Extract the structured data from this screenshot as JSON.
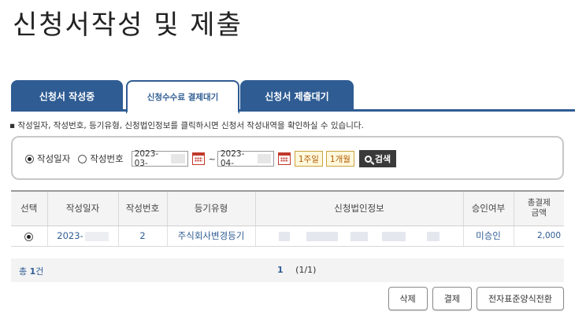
{
  "page": {
    "title": "신청서작성 및 제출"
  },
  "tabs": [
    {
      "label": "신청서 작성중",
      "active": false
    },
    {
      "label": "신청수수료 결제대기",
      "active": true
    },
    {
      "label": "신청서 제출대기",
      "active": false
    }
  ],
  "notice": "▪ 작성일자, 작성번호, 등기유형, 신청법인정보를 클릭하시면 신청서 작성내역을 확인하실 수 있습니다.",
  "search": {
    "radio_date_label": "작성일자",
    "radio_number_label": "작성번호",
    "selected": "date",
    "date_from": "2023-03-",
    "date_to": "2023-04-",
    "separator": "~",
    "week_btn": "1주일",
    "month_btn": "1개월",
    "search_btn": "검색"
  },
  "table": {
    "headers": [
      "선택",
      "작성일자",
      "작성번호",
      "등기유형",
      "신청법인정보",
      "승인여부",
      "총결제\n금액"
    ],
    "header_total_line1": "총결제",
    "header_total_line2": "금액",
    "rows": [
      {
        "date": "2023-",
        "number": "2",
        "type": "주식회사변경등기",
        "approval": "미승인",
        "amount": "2,000"
      }
    ]
  },
  "pager": {
    "total_prefix": "총",
    "total_count": "1",
    "total_suffix": "건",
    "current": "1",
    "info": "(1/1)"
  },
  "actions": {
    "delete": "삭제",
    "pay": "결제",
    "convert": "전자표준양식전환"
  },
  "colors": {
    "accent": "#2f5c93",
    "period_text": "#b25b00",
    "search_btn": "#3a3a3a"
  }
}
